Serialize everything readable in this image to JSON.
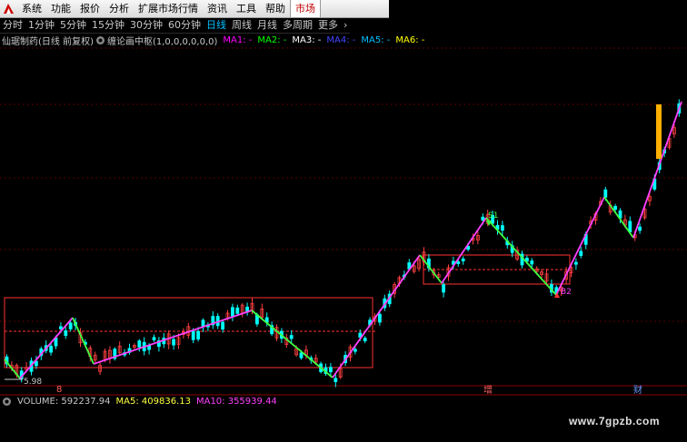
{
  "menu": {
    "items": [
      "系统",
      "功能",
      "报价",
      "分析",
      "扩展市场行情",
      "资讯",
      "工具",
      "帮助",
      "市场"
    ],
    "active_label": "市场"
  },
  "periods": {
    "items": [
      "分时",
      "1分钟",
      "5分钟",
      "15分钟",
      "30分钟",
      "60分钟",
      "日线",
      "周线",
      "月线",
      "多周期",
      "更多"
    ],
    "selected": "日线",
    "more_arrow": "›"
  },
  "indicator": {
    "stock": "仙琚制药(日线 前复权)",
    "name": "缠论画中枢(1,0,0,0,0,0,0)",
    "ma": [
      {
        "label": "MA1: -",
        "color": "#ff00ff"
      },
      {
        "label": "MA2: -",
        "color": "#00ff00"
      },
      {
        "label": "MA3: -",
        "color": "#ffffff"
      },
      {
        "label": "MA4: -",
        "color": "#4444ff"
      },
      {
        "label": "MA5: -",
        "color": "#00bfff"
      },
      {
        "label": "MA6: -",
        "color": "#ffff00"
      }
    ]
  },
  "chart_labels": {
    "low_price": "5.98",
    "s1": "S1",
    "b2": "B2"
  },
  "bottom_markers": {
    "left": "8",
    "middle": "增",
    "right": "财"
  },
  "volume": {
    "icon": "gear-icon",
    "volume_text": "VOLUME: 592237.94",
    "ma5_text": "MA5: 409836.13",
    "ma10_text": "MA10: 355939.44",
    "arrow": "↑"
  },
  "colors": {
    "up": "#ff4040",
    "down": "#00ffff",
    "stroke_up": "#ff40ff",
    "stroke_down": "#40ff40",
    "zhongshu": "#ff3030",
    "grid": "#8b0000",
    "accent": "#00bfff"
  },
  "watermark": "www.7gpzb.com"
}
